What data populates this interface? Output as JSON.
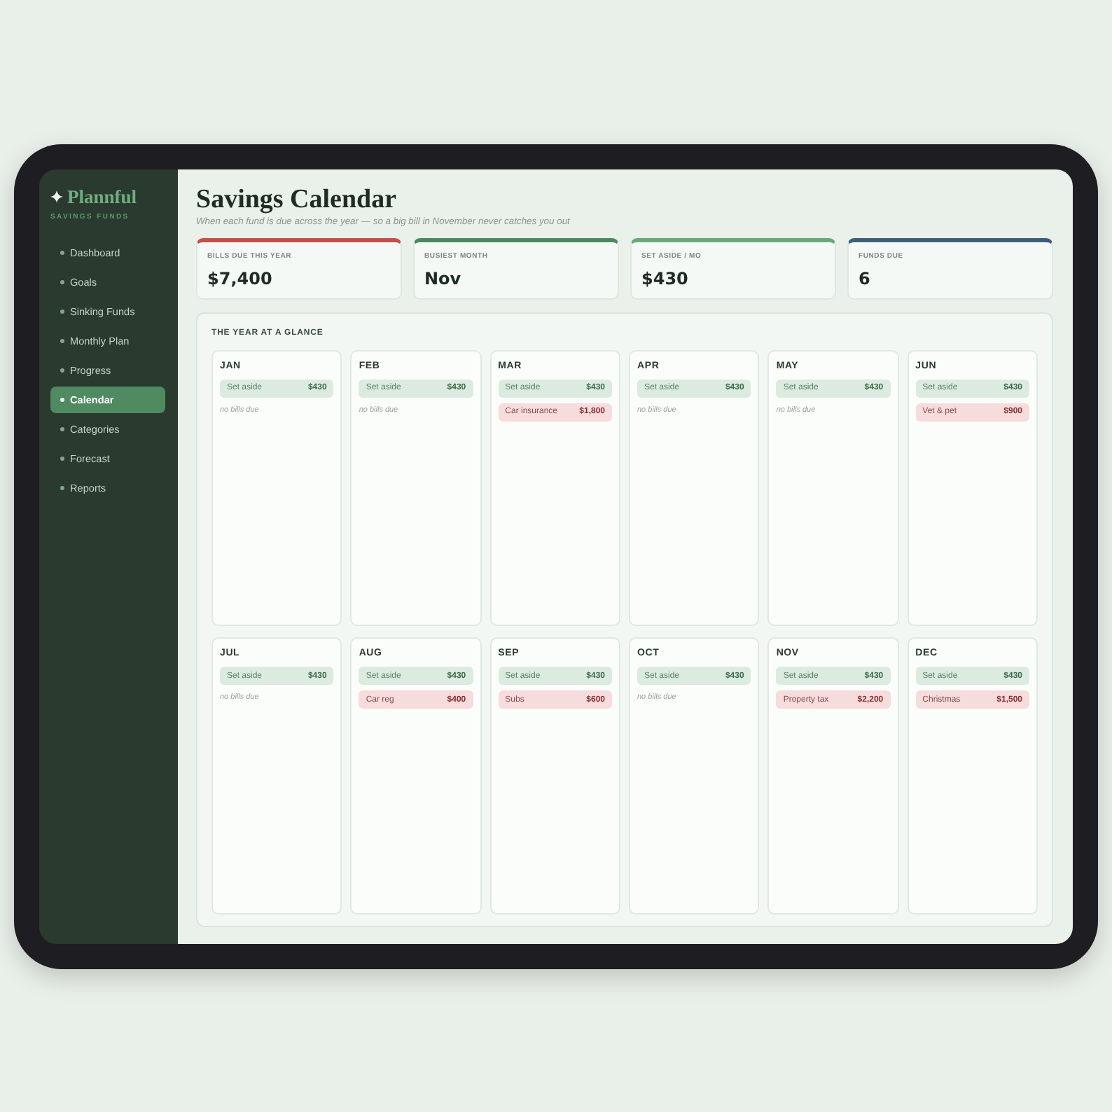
{
  "sidebar": {
    "logo": "Plannful",
    "tagline": "SAVINGS FUNDS",
    "items": [
      {
        "label": "Dashboard",
        "selected": false
      },
      {
        "label": "Goals",
        "selected": false
      },
      {
        "label": "Sinking Funds",
        "selected": false
      },
      {
        "label": "Monthly Plan",
        "selected": false
      },
      {
        "label": "Progress",
        "selected": false
      },
      {
        "label": "Calendar",
        "selected": true
      },
      {
        "label": "Categories",
        "selected": false
      },
      {
        "label": "Forecast",
        "selected": false
      },
      {
        "label": "Reports",
        "selected": false
      }
    ]
  },
  "header": {
    "title": "Savings Calendar",
    "subtitle": "When each fund is due across the year — so a big bill in November never catches you out"
  },
  "stats": [
    {
      "label": "BILLS DUE THIS YEAR",
      "value": "$7,400",
      "color": "#c0524a"
    },
    {
      "label": "BUSIEST MONTH",
      "value": "Nov",
      "color": "#4a8a5e"
    },
    {
      "label": "SET ASIDE / MO",
      "value": "$430",
      "color": "#6aaa78"
    },
    {
      "label": "FUNDS DUE",
      "value": "6",
      "color": "#3e5f78"
    }
  ],
  "calendar": {
    "heading": "THE YEAR AT A GLANCE",
    "months": [
      {
        "name": "JAN",
        "items": [
          {
            "kind": "saving",
            "label": "Set aside",
            "amount": "$430"
          }
        ],
        "note": "no bills due"
      },
      {
        "name": "FEB",
        "items": [
          {
            "kind": "saving",
            "label": "Set aside",
            "amount": "$430"
          }
        ],
        "note": "no bills due"
      },
      {
        "name": "MAR",
        "items": [
          {
            "kind": "saving",
            "label": "Set aside",
            "amount": "$430"
          },
          {
            "kind": "bill",
            "label": "Car insurance",
            "amount": "$1,800"
          }
        ]
      },
      {
        "name": "APR",
        "items": [
          {
            "kind": "saving",
            "label": "Set aside",
            "amount": "$430"
          }
        ],
        "note": "no bills due"
      },
      {
        "name": "MAY",
        "items": [
          {
            "kind": "saving",
            "label": "Set aside",
            "amount": "$430"
          }
        ],
        "note": "no bills due"
      },
      {
        "name": "JUN",
        "items": [
          {
            "kind": "saving",
            "label": "Set aside",
            "amount": "$430"
          },
          {
            "kind": "bill",
            "label": "Vet & pet",
            "amount": "$900"
          }
        ]
      },
      {
        "name": "JUL",
        "items": [
          {
            "kind": "saving",
            "label": "Set aside",
            "amount": "$430"
          }
        ],
        "note": "no bills due"
      },
      {
        "name": "AUG",
        "items": [
          {
            "kind": "saving",
            "label": "Set aside",
            "amount": "$430"
          },
          {
            "kind": "bill",
            "label": "Car reg",
            "amount": "$400"
          }
        ]
      },
      {
        "name": "SEP",
        "items": [
          {
            "kind": "saving",
            "label": "Set aside",
            "amount": "$430"
          },
          {
            "kind": "bill",
            "label": "Subs",
            "amount": "$600"
          }
        ]
      },
      {
        "name": "OCT",
        "items": [
          {
            "kind": "saving",
            "label": "Set aside",
            "amount": "$430"
          }
        ],
        "note": "no bills due"
      },
      {
        "name": "NOV",
        "items": [
          {
            "kind": "saving",
            "label": "Set aside",
            "amount": "$430"
          },
          {
            "kind": "bill",
            "label": "Property tax",
            "amount": "$2,200"
          }
        ]
      },
      {
        "name": "DEC",
        "items": [
          {
            "kind": "saving",
            "label": "Set aside",
            "amount": "$430"
          },
          {
            "kind": "bill",
            "label": "Christmas",
            "amount": "$1,500"
          }
        ]
      }
    ]
  }
}
